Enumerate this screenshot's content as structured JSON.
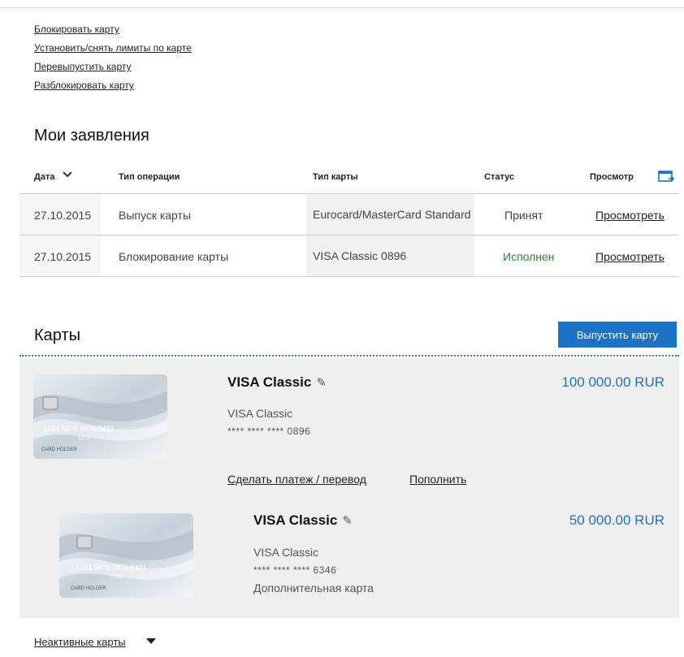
{
  "links": {
    "block": "Блокировать карту",
    "limits": "Установить/снять лимиты по карте",
    "reissue": "Перевыпустить карту",
    "unblock": "Разблокировать карту"
  },
  "applications": {
    "title": "Мои заявления",
    "columns": {
      "date": "Дата",
      "operation": "Тип операции",
      "card_type": "Тип карты",
      "status": "Статус",
      "view": "Просмотр"
    },
    "rows": [
      {
        "date": "27.10.2015",
        "operation": "Выпуск карты",
        "card_type": "Eurocard/MasterCard Standard",
        "status": "Принят",
        "view": "Просмотреть"
      },
      {
        "date": "27.10.2015",
        "operation": "Блокирование карты",
        "card_type": "VISA Classic 0896",
        "status": "Исполнен",
        "view": "Просмотреть"
      }
    ]
  },
  "cards": {
    "title": "Карты",
    "issue_button": "Выпустить карту",
    "items": [
      {
        "name": "VISA Classic",
        "type": "VISA Classic",
        "number": "**** **** **** 0896",
        "balance": "100 000.00 RUR",
        "card_face": {
          "digits": "1234 5678 9876 5421",
          "expiry": "12/15",
          "holder": "CARD HOLDER"
        }
      },
      {
        "name": "VISA Classic",
        "type": "VISA Classic",
        "number": "**** **** **** 6346",
        "extra": "Дополнительная карта",
        "balance": "50 000.00 RUR",
        "card_face": {
          "digits": "1234 5678 9876 5421",
          "expiry": "12/15",
          "holder": "CARD HOLDER"
        }
      }
    ],
    "actions": {
      "payment": "Сделать платеж / перевод",
      "topup": "Пополнить"
    }
  },
  "inactive_cards": "Неактивные карты",
  "colors": {
    "accent": "#1a73c7",
    "status_ok": "#1e8a3a",
    "panel_bg": "#efefef"
  }
}
